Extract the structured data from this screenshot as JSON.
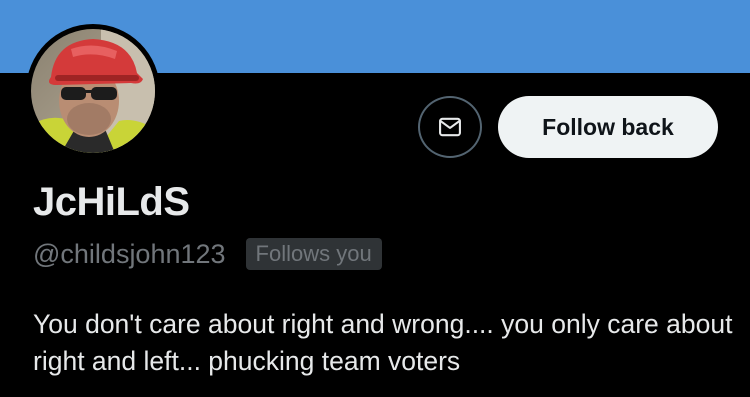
{
  "colors": {
    "banner": "#4a90d9",
    "background": "#000000",
    "follow_button_bg": "#eff3f4",
    "muted_text": "#71767b"
  },
  "profile": {
    "display_name": "JcHiLdS",
    "handle": "@childsjohn123",
    "follows_you_badge": "Follows you",
    "bio": "You don't care about right and wrong.... you only care about right and left... phucking team voters"
  },
  "actions": {
    "message_icon": "envelope-icon",
    "follow_label": "Follow back"
  }
}
